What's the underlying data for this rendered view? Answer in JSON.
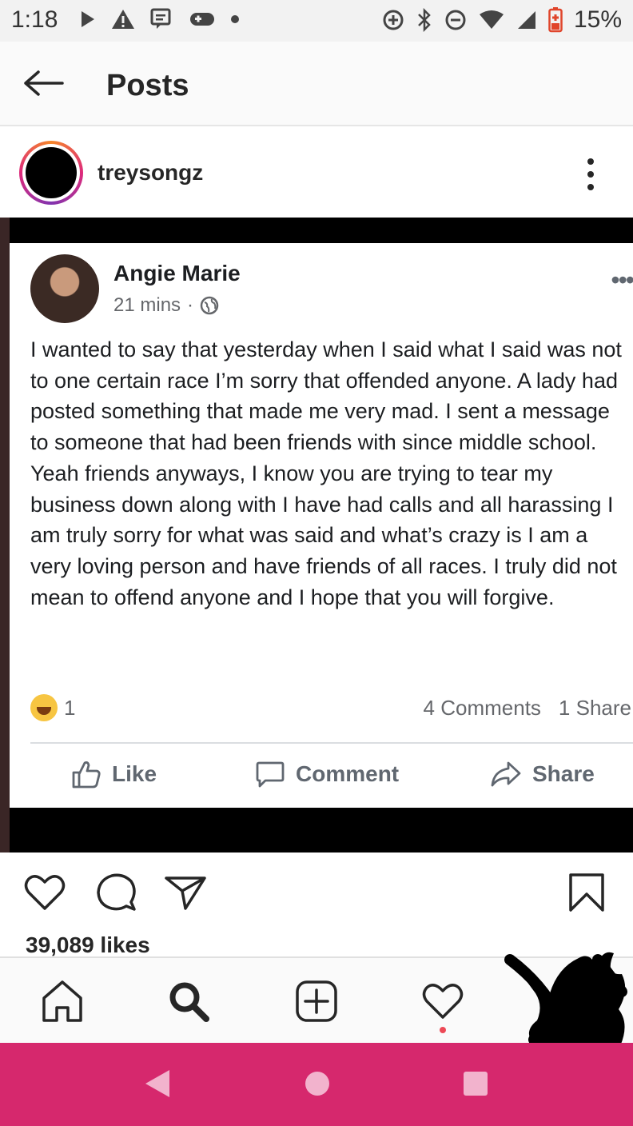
{
  "status_bar": {
    "time": "1:18",
    "battery_percent": "15%",
    "icons": [
      "play-icon",
      "warning-icon",
      "chat-icon",
      "gamepad-icon",
      "dot-icon",
      "data-saver-icon",
      "bluetooth-icon",
      "dnd-icon",
      "wifi-icon",
      "signal-icon",
      "battery-low-icon"
    ]
  },
  "header": {
    "title": "Posts"
  },
  "post": {
    "username": "treysongz",
    "likes": "39,089 likes"
  },
  "fb_post": {
    "name": "Angie Marie",
    "time": "21 mins",
    "separator": "·",
    "text": "I wanted to say that yesterday when I said what I said was not to one certain race I’m sorry that offended anyone. A lady had posted something that made me very mad. I sent a message to someone that had been friends with since middle school. Yeah friends anyways, I know you are trying to tear my business down along with I have had calls and all harassing I am truly sorry for what was said and what’s crazy is I am a very loving person and have friends of all races. I truly did not mean to offend anyone and I hope that you will forgive.",
    "reaction_count": "1",
    "comments": "4 Comments",
    "shares": "1 Share",
    "actions": {
      "like": "Like",
      "comment": "Comment",
      "share": "Share"
    }
  },
  "colors": {
    "accent": "#d6286d",
    "notification": "#ed4956",
    "fb_gray": "#606770"
  }
}
